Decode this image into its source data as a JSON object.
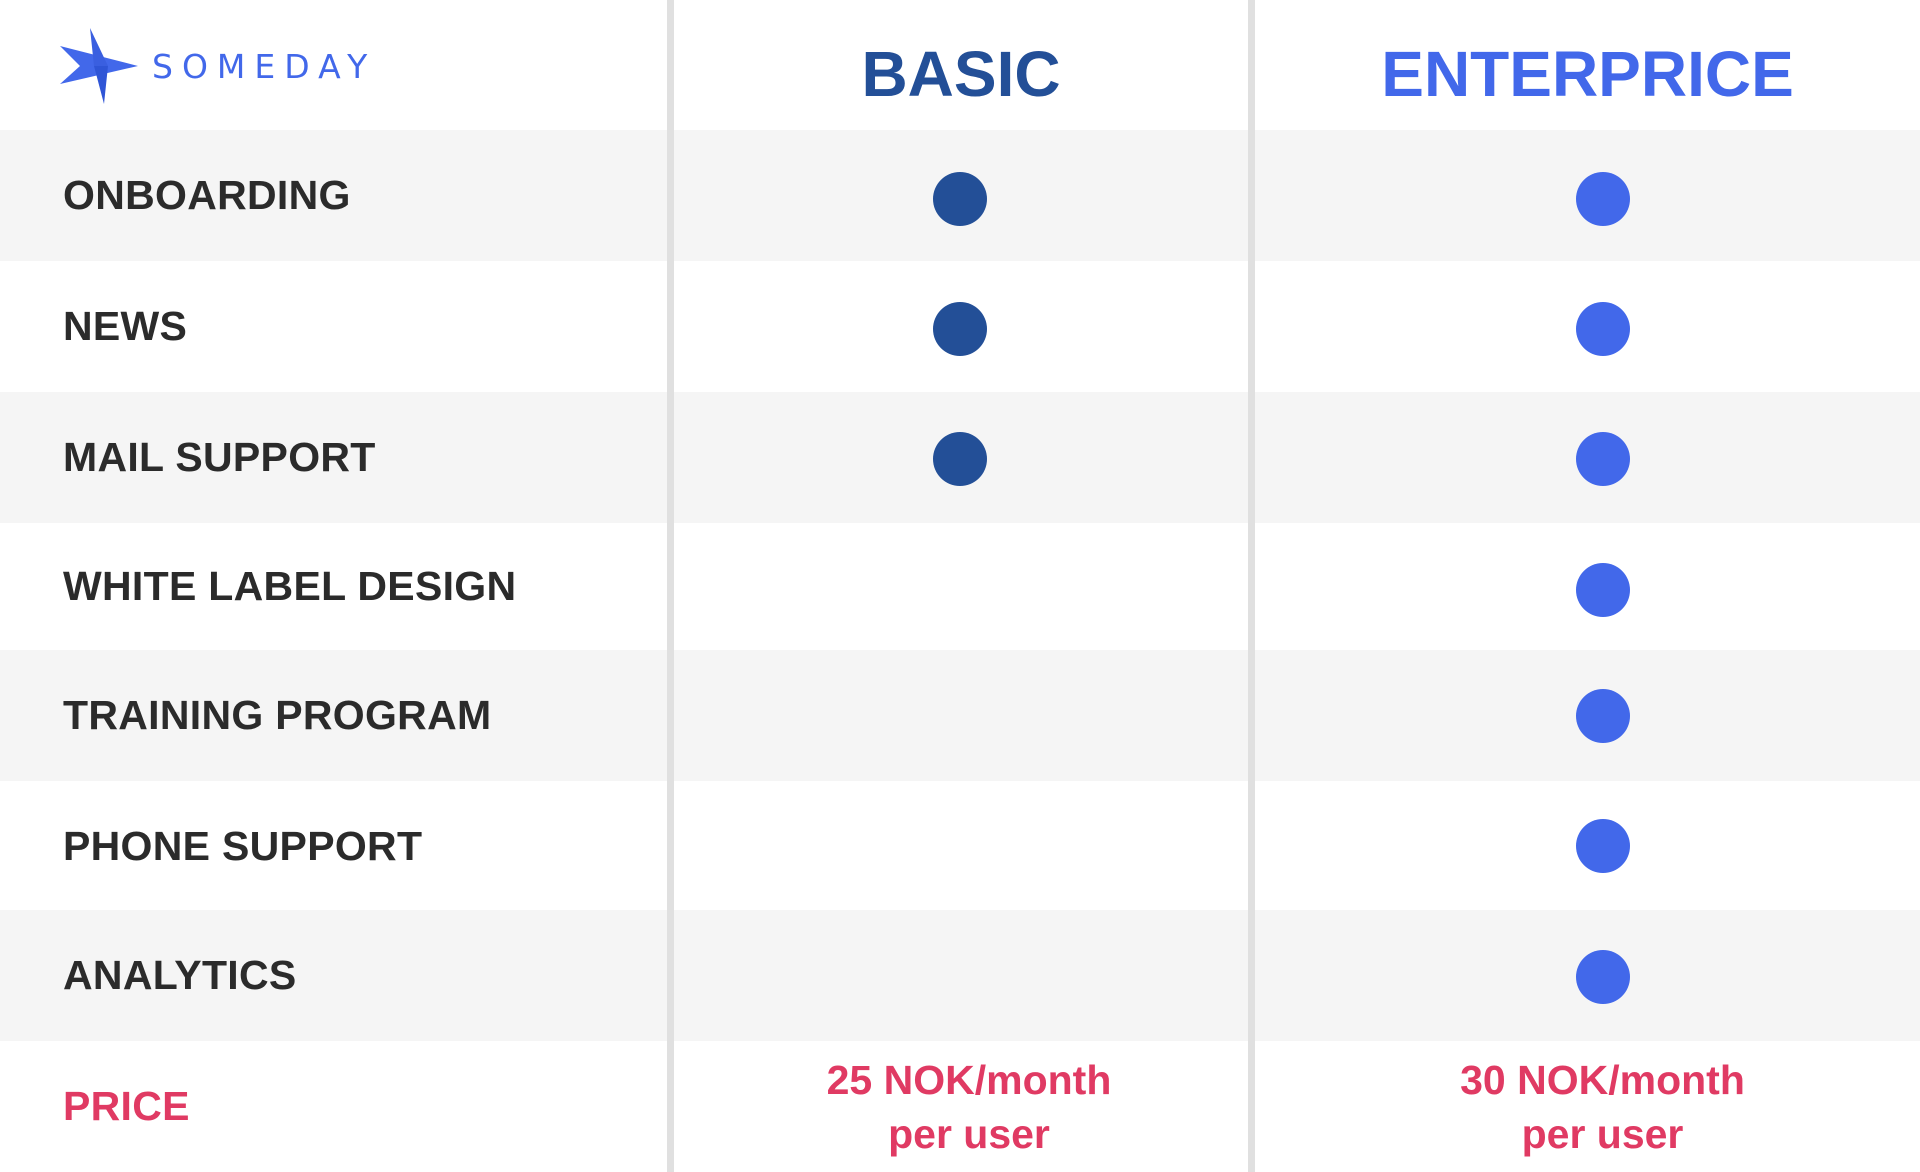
{
  "brand": {
    "name": "SOMEDAY",
    "color": "#4268ea"
  },
  "columns": {
    "basic": {
      "title": "BASIC",
      "color": "#234f97"
    },
    "enterprise": {
      "title": "ENTERPRICE",
      "color": "#4268ea"
    }
  },
  "features": [
    {
      "label": "ONBOARDING",
      "basic": true,
      "enterprise": true
    },
    {
      "label": "NEWS",
      "basic": true,
      "enterprise": true
    },
    {
      "label": "MAIL SUPPORT",
      "basic": true,
      "enterprise": true
    },
    {
      "label": "WHITE LABEL DESIGN",
      "basic": false,
      "enterprise": true
    },
    {
      "label": "TRAINING PROGRAM",
      "basic": false,
      "enterprise": true
    },
    {
      "label": "PHONE SUPPORT",
      "basic": false,
      "enterprise": true
    },
    {
      "label": "ANALYTICS",
      "basic": false,
      "enterprise": true
    }
  ],
  "price": {
    "label": "PRICE",
    "basic_line1": "25 NOK/month",
    "basic_line2": "per user",
    "enterprise_line1": "30 NOK/month",
    "enterprise_line2": "per user",
    "color": "#e03a63"
  }
}
